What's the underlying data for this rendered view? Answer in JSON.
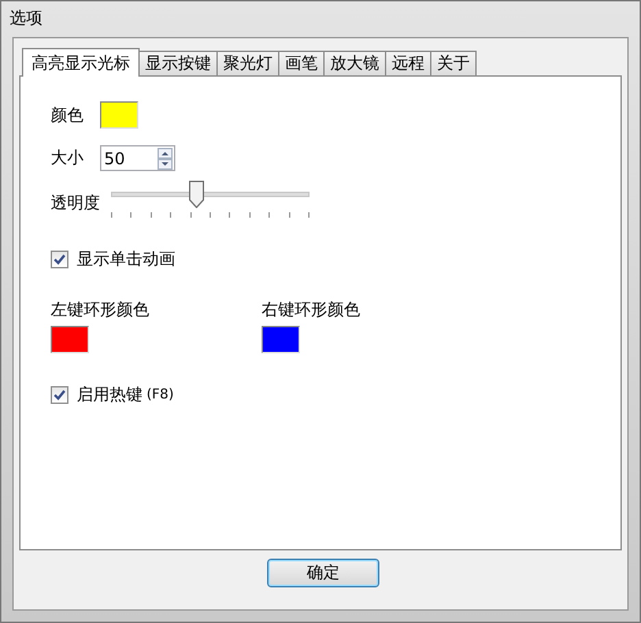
{
  "window": {
    "title": "选项"
  },
  "tabs": [
    {
      "label": "高亮显示光标",
      "selected": true
    },
    {
      "label": "显示按键",
      "selected": false
    },
    {
      "label": "聚光灯",
      "selected": false
    },
    {
      "label": "画笔",
      "selected": false
    },
    {
      "label": "放大镜",
      "selected": false
    },
    {
      "label": "远程",
      "selected": false
    },
    {
      "label": "关于",
      "selected": false
    }
  ],
  "color": {
    "label": "颜色",
    "color": "#ffff00"
  },
  "size": {
    "label": "大小",
    "value": "50"
  },
  "opacity": {
    "label": "透明度",
    "level": 0.43
  },
  "click_animation": {
    "label": "显示单击动画",
    "checked": true
  },
  "ring_colors": [
    {
      "label": "左键环形颜色",
      "color": "#ff0000"
    },
    {
      "label": "右键环形颜色",
      "color": "#0000ff"
    }
  ],
  "hotkey": {
    "label": "启用热键",
    "hint": "(F8)",
    "checked": true
  },
  "buttons": [
    "确定"
  ]
}
